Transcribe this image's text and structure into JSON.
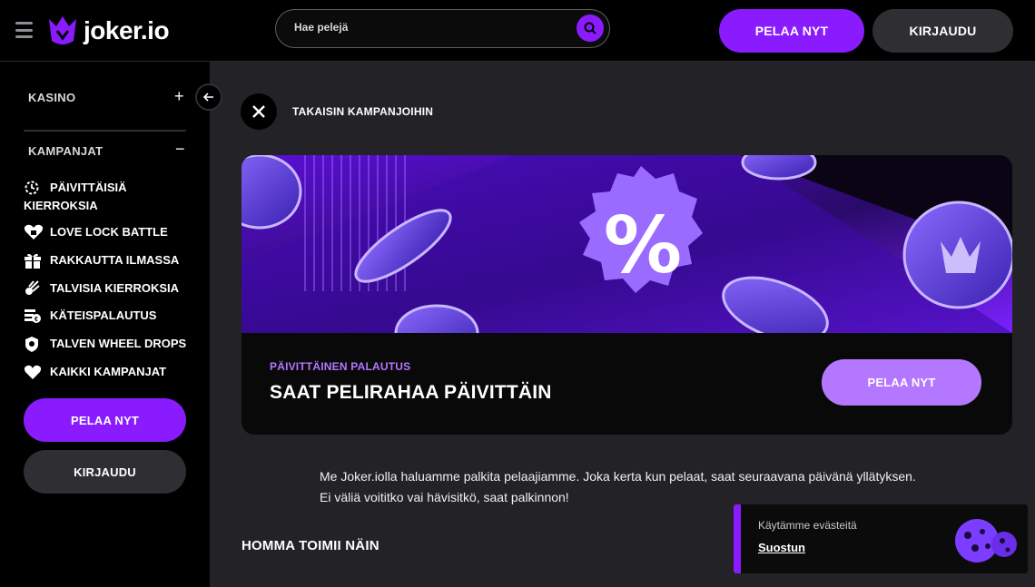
{
  "header": {
    "logo_text": "joker.io",
    "search_placeholder": "Hae pelejä",
    "play_label": "PELAA NYT",
    "login_label": "KIRJAUDU"
  },
  "sidebar": {
    "casino_label": "KASINO",
    "campaigns_label": "KAMPANJAT",
    "items": [
      {
        "label": "PÄIVITTÄISIÄ KIERROKSIA",
        "icon": "clock-spin-icon"
      },
      {
        "label": "LOVE LOCK BATTLE",
        "icon": "heart-lock-icon"
      },
      {
        "label": "RAKKAUTTA ILMASSA",
        "icon": "gift-icon"
      },
      {
        "label": "TALVISIA KIERROKSIA",
        "icon": "comet-icon"
      },
      {
        "label": "KÄTEISPALAUTUS",
        "icon": "cashback-icon"
      },
      {
        "label": "TALVEN WHEEL DROPS",
        "icon": "shield-icon"
      },
      {
        "label": "KAIKKI KAMPANJAT",
        "icon": "heart-icon"
      }
    ],
    "play_label": "PELAA NYT",
    "login_label": "KIRJAUDU"
  },
  "main": {
    "back_label": "TAKAISIN KAMPANJOIHIN",
    "promo": {
      "subtitle": "PÄIVITTÄINEN PALAUTUS",
      "title": "SAAT PELIRAHAA PÄIVITTÄIN",
      "play_label": "PELAA NYT",
      "badge_symbol": "%"
    },
    "description": "Me Joker.iolla haluamme palkita pelaajiamme. Joka kerta kun pelaat, saat seuraavana päivänä yllätyksen. Ei väliä voititko vai hävisitkö, saat palkinnon!",
    "section_title": "HOMMA TOIMII NÄIN"
  },
  "cookie": {
    "text": "Käytämme evästeitä",
    "accept_label": "Suostun"
  },
  "colors": {
    "accent": "#8a1bff",
    "accent_light": "#b477ff",
    "background": "#232226",
    "panel": "#000000"
  }
}
